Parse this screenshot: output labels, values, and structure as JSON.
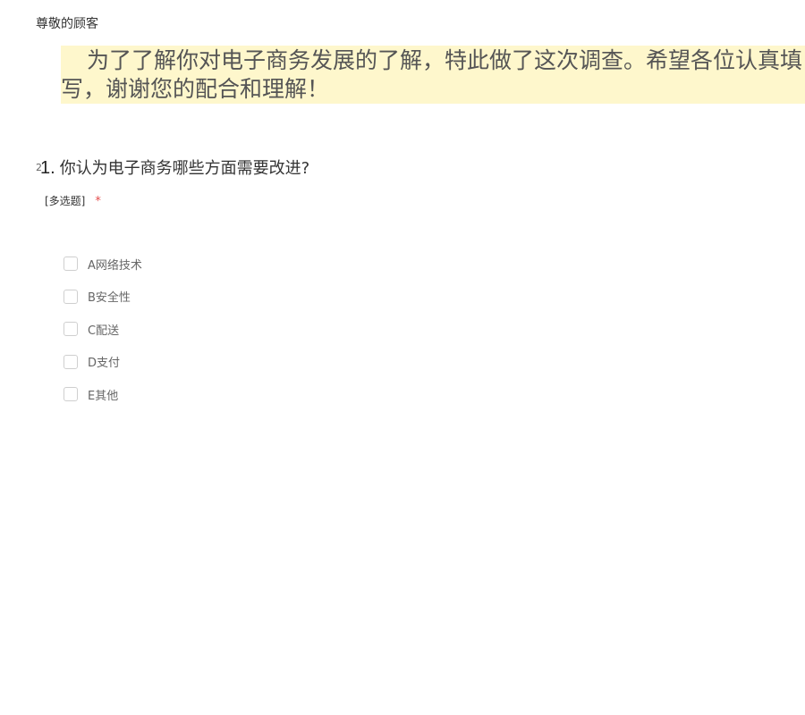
{
  "greeting": "尊敬的顾客",
  "intro_text": "为了了解你对电子商务发展的了解，特此做了这次调查。希望各位认真填写，谢谢您的配合和理解！",
  "question": {
    "marker": "2",
    "number": "1.",
    "title": "你认为电子商务哪些方面需要改进?",
    "type_label": "[多选题]",
    "required_mark": "*",
    "options": [
      {
        "label": "A网络技术",
        "checked": false
      },
      {
        "label": "B安全性",
        "checked": false
      },
      {
        "label": "C配送",
        "checked": false
      },
      {
        "label": "D支付",
        "checked": false
      },
      {
        "label": "E其他",
        "checked": false
      }
    ]
  },
  "colors": {
    "highlight": "#fef7cc",
    "required": "#e44d4d",
    "checkbox_border": "#cfcfcf"
  }
}
